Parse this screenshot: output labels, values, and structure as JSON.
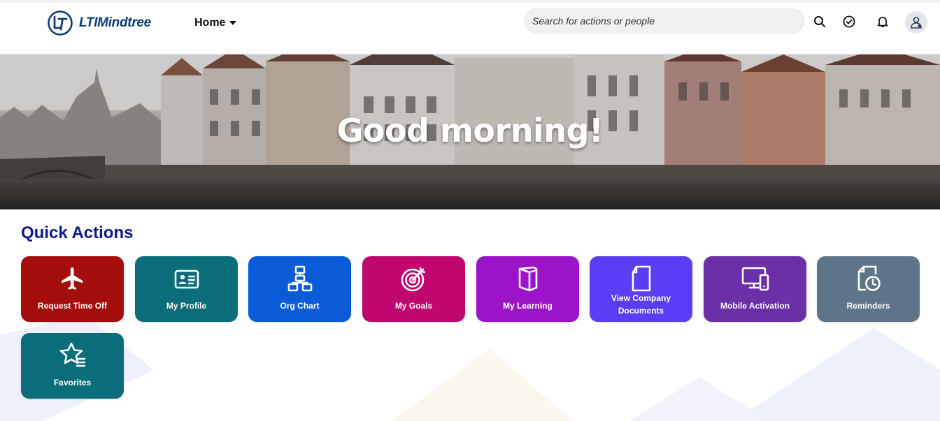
{
  "header": {
    "logo_text": "LTIMindtree",
    "nav_label": "Home",
    "search_placeholder": "Search for actions or people",
    "icons": [
      "search-icon",
      "approvals-check-icon",
      "notification-bell-icon",
      "user-avatar-icon"
    ]
  },
  "hero": {
    "greeting": "Good morning!"
  },
  "quick_actions": {
    "title": "Quick Actions",
    "tiles": [
      {
        "label": "Request Time Off",
        "icon": "airplane-icon",
        "color": "#a50d0d"
      },
      {
        "label": "My Profile",
        "icon": "id-card-icon",
        "color": "#0c6d7a"
      },
      {
        "label": "Org Chart",
        "icon": "org-chart-icon",
        "color": "#0b5ad8"
      },
      {
        "label": "My Goals",
        "icon": "target-icon",
        "color": "#c0066f"
      },
      {
        "label": "My Learning",
        "icon": "book-icon",
        "color": "#9b14c8"
      },
      {
        "label": "View Company Documents",
        "icon": "document-icon",
        "color": "#5a3df5"
      },
      {
        "label": "Mobile Activation",
        "icon": "devices-icon",
        "color": "#6b2fa8"
      },
      {
        "label": "Reminders",
        "icon": "clock-document-icon",
        "color": "#5e7589"
      },
      {
        "label": "Favorites",
        "icon": "star-list-icon",
        "color": "#0c6d7a"
      }
    ]
  }
}
